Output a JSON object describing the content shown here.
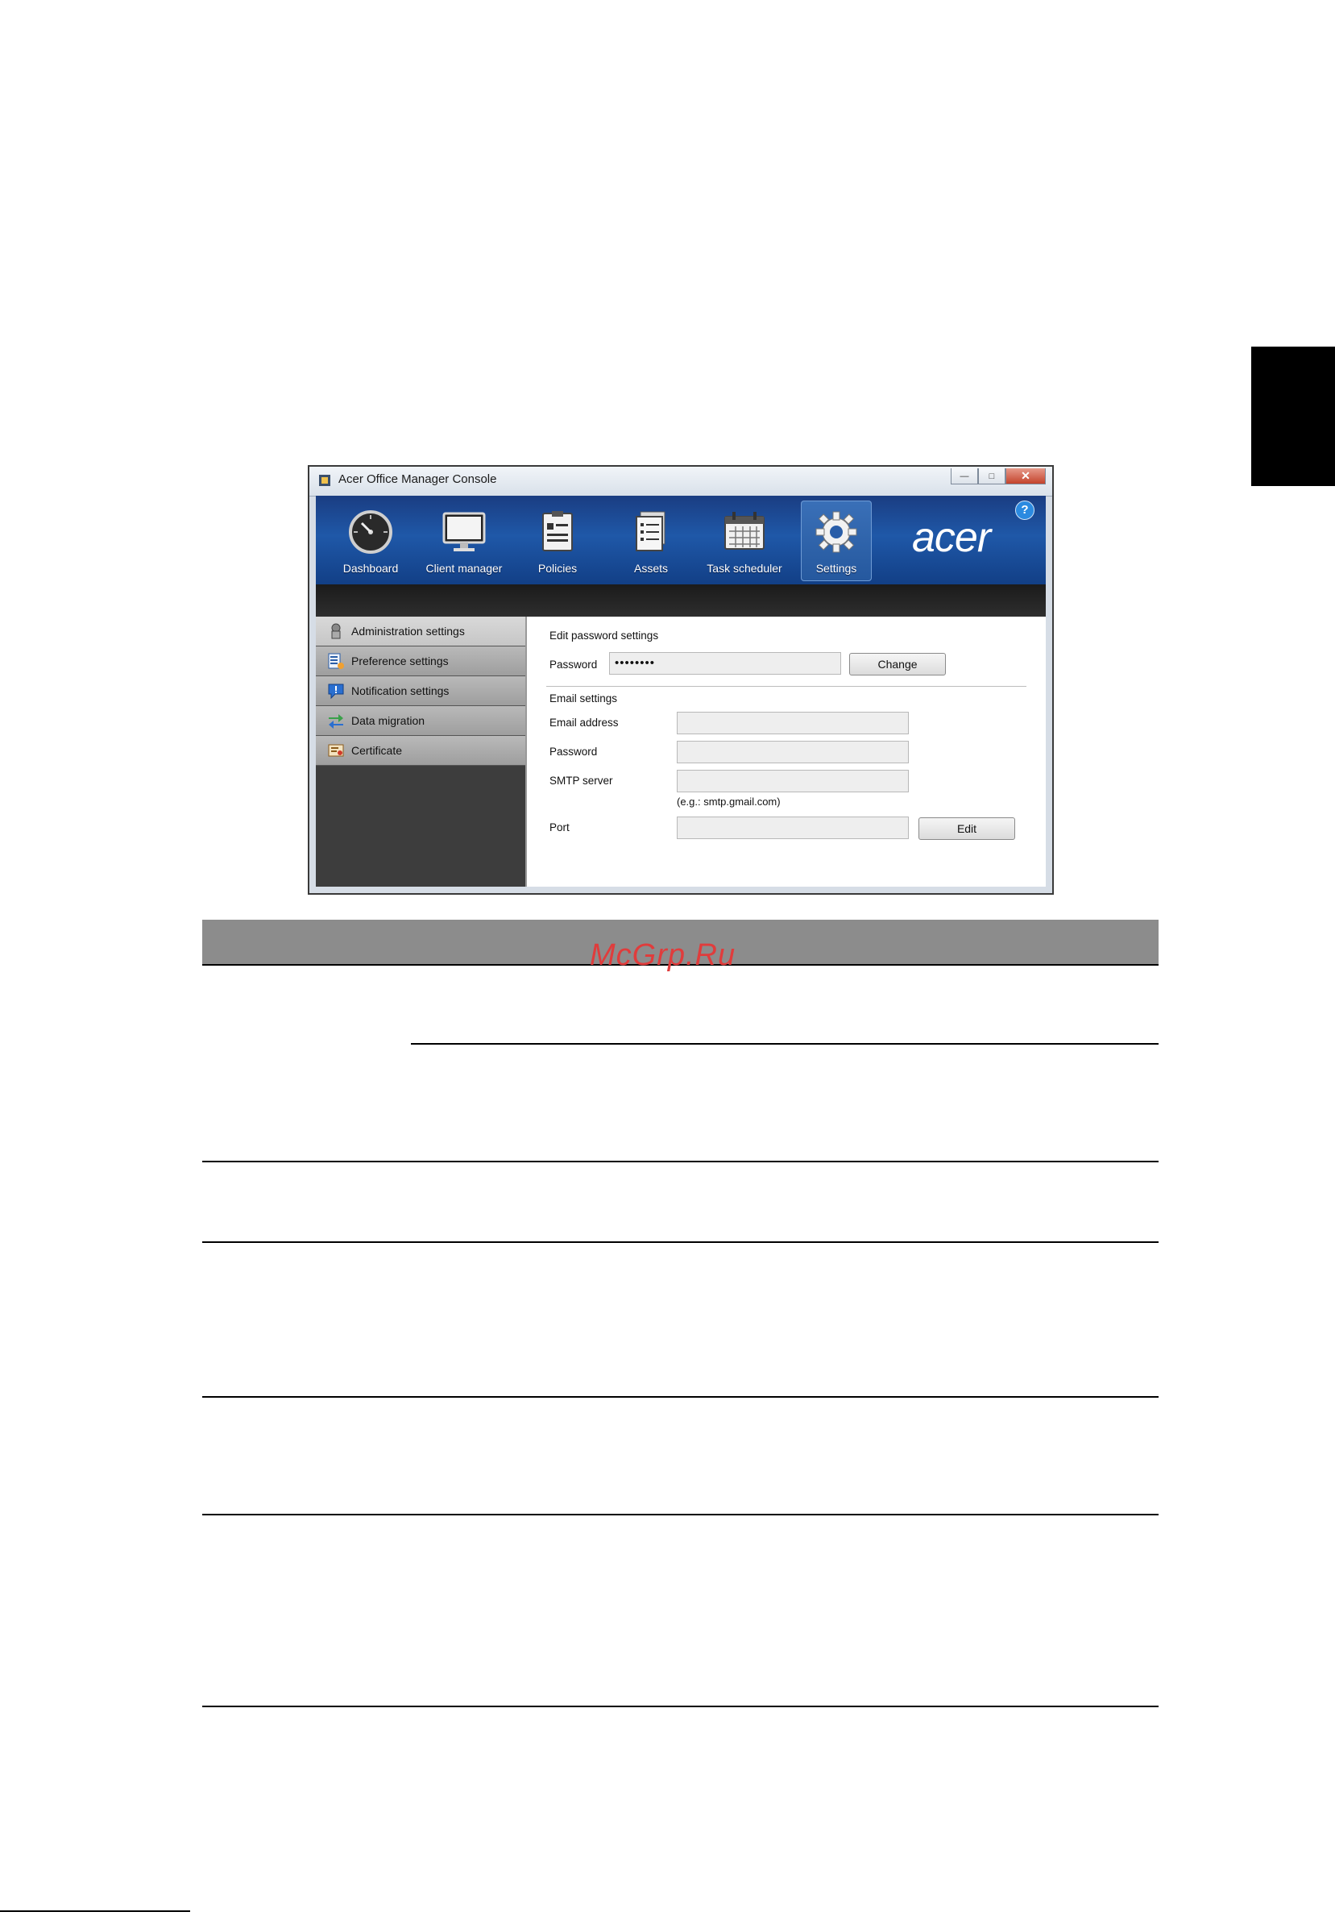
{
  "window": {
    "title": "Acer Office Manager Console",
    "controls": [
      "minimize",
      "maximize",
      "close"
    ]
  },
  "nav": {
    "items": [
      {
        "label": "Dashboard",
        "icon": "dashboard-icon"
      },
      {
        "label": "Client manager",
        "icon": "monitor-icon"
      },
      {
        "label": "Policies",
        "icon": "clipboard-icon"
      },
      {
        "label": "Assets",
        "icon": "document-list-icon"
      },
      {
        "label": "Task scheduler",
        "icon": "calendar-icon"
      },
      {
        "label": "Settings",
        "icon": "gear-icon",
        "active": true
      }
    ],
    "logo": "acer",
    "help": "?"
  },
  "sidebar": {
    "items": [
      {
        "label": "Administration settings",
        "active": true
      },
      {
        "label": "Preference settings"
      },
      {
        "label": "Notification settings"
      },
      {
        "label": "Data migration"
      },
      {
        "label": "Certificate"
      }
    ]
  },
  "content": {
    "password_section": {
      "heading": "Edit password settings",
      "password_label": "Password",
      "password_value": "••••••••",
      "change_button": "Change"
    },
    "email_section": {
      "heading": "Email settings",
      "email_label": "Email address",
      "password_label": "Password",
      "smtp_label": "SMTP server",
      "smtp_hint": "(e.g.: smtp.gmail.com)",
      "port_label": "Port",
      "edit_button": "Edit"
    }
  },
  "watermark": "McGrp.Ru",
  "colors": {
    "nav_blue": "#1f58a8",
    "table_header": "#8c8c8c",
    "watermark_red": "#e03c3c"
  }
}
